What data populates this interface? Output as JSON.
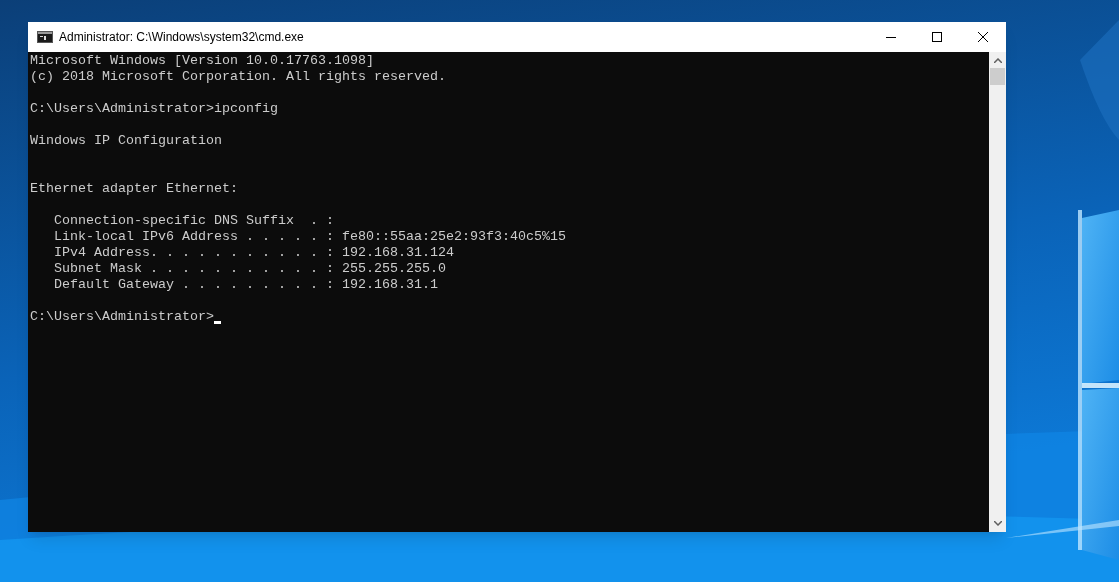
{
  "window": {
    "title": "Administrator: C:\\Windows\\system32\\cmd.exe"
  },
  "console": {
    "lines": [
      {
        "kind": "text",
        "text": "Microsoft Windows [Version 10.0.17763.1098]"
      },
      {
        "kind": "text",
        "text": "(c) 2018 Microsoft Corporation. All rights reserved."
      },
      {
        "kind": "blank"
      },
      {
        "kind": "text",
        "text": "C:\\Users\\Administrator>ipconfig"
      },
      {
        "kind": "blank"
      },
      {
        "kind": "text",
        "text": "Windows IP Configuration"
      },
      {
        "kind": "blank"
      },
      {
        "kind": "blank"
      },
      {
        "kind": "text",
        "text": "Ethernet adapter Ethernet:"
      },
      {
        "kind": "blank"
      },
      {
        "kind": "text",
        "text": "   Connection-specific DNS Suffix  . :"
      },
      {
        "kind": "text",
        "text": "   Link-local IPv6 Address . . . . . : fe80::55aa:25e2:93f3:40c5%15"
      },
      {
        "kind": "text",
        "text": "   IPv4 Address. . . . . . . . . . . : 192.168.31.124"
      },
      {
        "kind": "text",
        "text": "   Subnet Mask . . . . . . . . . . . : 255.255.255.0"
      },
      {
        "kind": "text",
        "text": "   Default Gateway . . . . . . . . . : 192.168.31.1"
      },
      {
        "kind": "blank"
      },
      {
        "kind": "prompt",
        "text": "C:\\Users\\Administrator>"
      }
    ]
  }
}
